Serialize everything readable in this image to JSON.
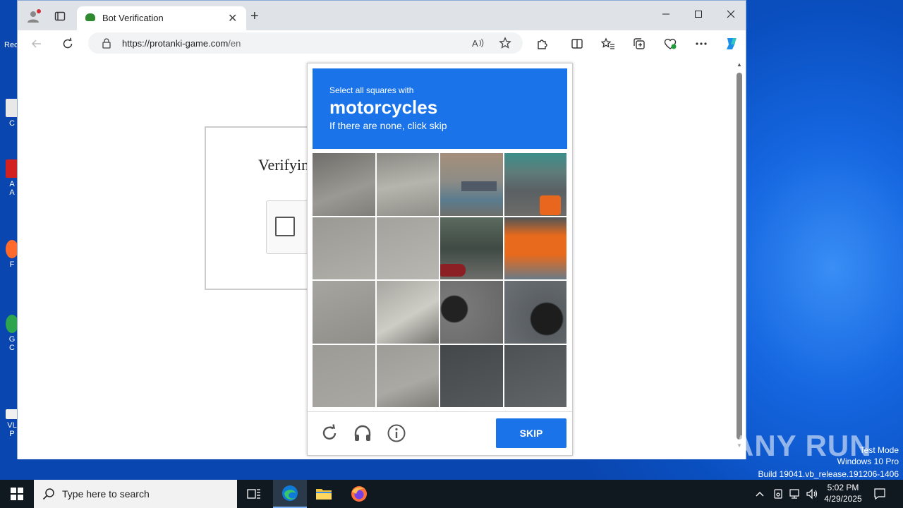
{
  "browser": {
    "tab_title": "Bot Verification",
    "url_host": "https://protanki-game.com",
    "url_path": "/en"
  },
  "page": {
    "verify_title": "Verifyin"
  },
  "challenge": {
    "instruction_small": "Select all squares with",
    "target_object": "motorcycles",
    "instruction_skip": "If there are none, click skip",
    "skip_button": "SKIP",
    "accent_color": "#1a73e8"
  },
  "watermark": {
    "brand": "ANY RUN",
    "line1": "Test Mode",
    "line2": "Windows 10 Pro",
    "line3": "Build 19041.vb_release.191206-1406"
  },
  "taskbar": {
    "search_placeholder": "Type here to search",
    "time": "5:02 PM",
    "date": "4/29/2025"
  },
  "desktop": {
    "partial_labels": [
      "Rec",
      "C",
      "A",
      "A",
      "F",
      "G",
      "C",
      "VL",
      "P"
    ]
  }
}
